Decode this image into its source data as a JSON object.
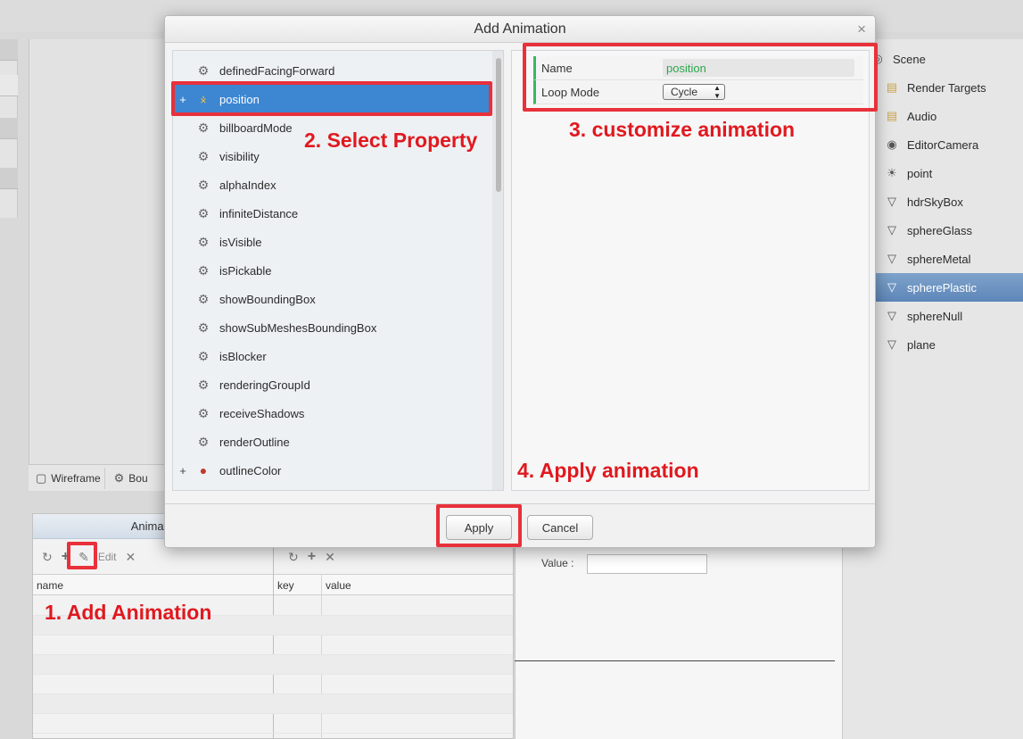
{
  "modal": {
    "title": "Add Animation",
    "close_symbol": "×",
    "properties": [
      {
        "label": "definedFacingForward",
        "icon": "gear-icon",
        "expandable": false,
        "selected": false
      },
      {
        "label": "position",
        "icon": "axis-gizmo-icon",
        "expandable": true,
        "selected": true
      },
      {
        "label": "billboardMode",
        "icon": "gear-icon",
        "expandable": false,
        "selected": false
      },
      {
        "label": "visibility",
        "icon": "gear-icon",
        "expandable": false,
        "selected": false
      },
      {
        "label": "alphaIndex",
        "icon": "gear-icon",
        "expandable": false,
        "selected": false
      },
      {
        "label": "infiniteDistance",
        "icon": "gear-icon",
        "expandable": false,
        "selected": false
      },
      {
        "label": "isVisible",
        "icon": "gear-icon",
        "expandable": false,
        "selected": false
      },
      {
        "label": "isPickable",
        "icon": "gear-icon",
        "expandable": false,
        "selected": false
      },
      {
        "label": "showBoundingBox",
        "icon": "gear-icon",
        "expandable": false,
        "selected": false
      },
      {
        "label": "showSubMeshesBoundingBox",
        "icon": "gear-icon",
        "expandable": false,
        "selected": false
      },
      {
        "label": "isBlocker",
        "icon": "gear-icon",
        "expandable": false,
        "selected": false
      },
      {
        "label": "renderingGroupId",
        "icon": "gear-icon",
        "expandable": false,
        "selected": false
      },
      {
        "label": "receiveShadows",
        "icon": "gear-icon",
        "expandable": false,
        "selected": false
      },
      {
        "label": "renderOutline",
        "icon": "gear-icon",
        "expandable": false,
        "selected": false
      },
      {
        "label": "outlineColor",
        "icon": "color-ball-icon",
        "expandable": true,
        "selected": false
      }
    ],
    "expand_symbol": "+",
    "config": {
      "name_label": "Name",
      "name_value": "position",
      "loop_label": "Loop Mode",
      "loop_value": "Cycle"
    },
    "apply_label": "Apply",
    "cancel_label": "Cancel"
  },
  "annotations": {
    "step1": "1. Add Animation",
    "step2": "2. Select Property",
    "step3": "3. customize animation",
    "step4": "4. Apply animation",
    "highlight_color": "#e8313b"
  },
  "scene_tree": [
    {
      "label": "Scene",
      "icon": "scene-icon",
      "selected": false
    },
    {
      "label": "Render Targets",
      "icon": "folder-icon",
      "selected": false
    },
    {
      "label": "Audio",
      "icon": "folder-icon",
      "selected": false
    },
    {
      "label": "EditorCamera",
      "icon": "camera-icon",
      "selected": false
    },
    {
      "label": "point",
      "icon": "lightbulb-icon",
      "selected": false
    },
    {
      "label": "hdrSkyBox",
      "icon": "mesh-icon",
      "selected": false
    },
    {
      "label": "sphereGlass",
      "icon": "mesh-icon",
      "selected": false
    },
    {
      "label": "sphereMetal",
      "icon": "mesh-icon",
      "selected": false
    },
    {
      "label": "spherePlastic",
      "icon": "mesh-icon",
      "selected": true
    },
    {
      "label": "sphereNull",
      "icon": "mesh-icon",
      "selected": false
    },
    {
      "label": "plane",
      "icon": "mesh-icon",
      "selected": false
    }
  ],
  "viewport_toolbar": {
    "wireframe_label": "Wireframe",
    "bounding_label": "Bou"
  },
  "animations_panel": {
    "title": "Animatio",
    "edit_label": "Edit",
    "col_name": "name",
    "col_key": "key",
    "col_value": "value",
    "value_label": "Value :"
  },
  "colors": {
    "selection_blue": "#3d86d2",
    "scene_selection": "#6a90bf",
    "name_green": "#2aa74c",
    "annotation_red": "#e0191f"
  }
}
